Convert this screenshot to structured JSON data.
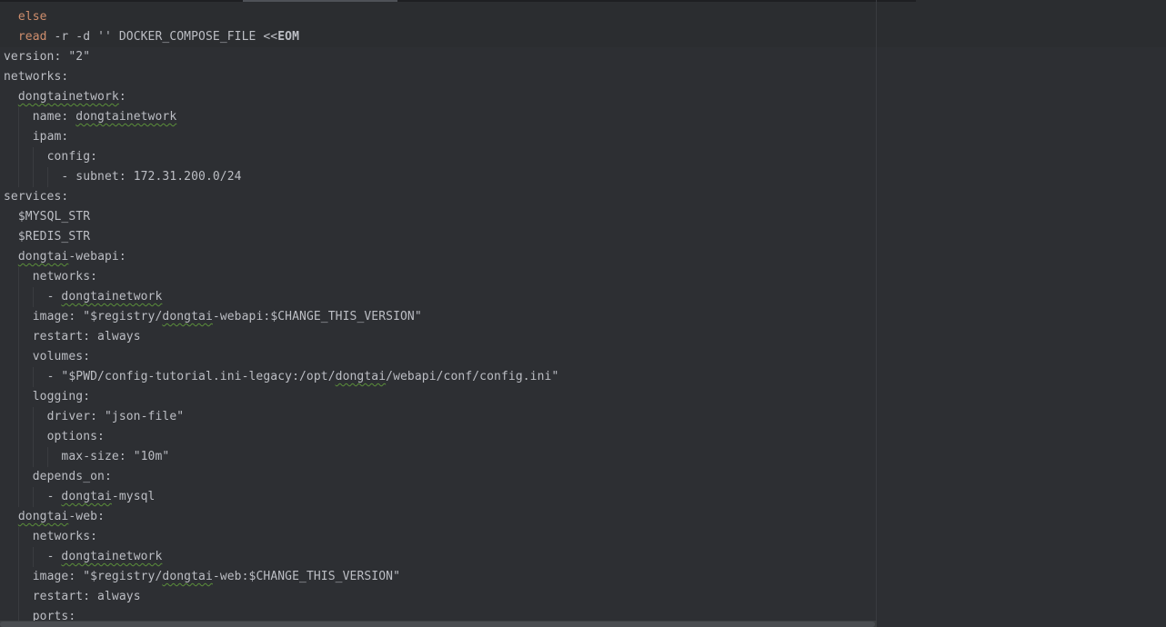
{
  "editor": {
    "lines": [
      {
        "indent": "  ",
        "segments": [
          {
            "text": "else",
            "style": "kw"
          }
        ]
      },
      {
        "indent": "  ",
        "segments": [
          {
            "text": "read",
            "style": "kw"
          },
          {
            "text": " -r -d '' DOCKER_COMPOSE_FILE <<",
            "style": ""
          },
          {
            "text": "EOM",
            "style": "bold"
          }
        ]
      },
      {
        "indent": "",
        "segments": [
          {
            "text": "version: \"2\"",
            "style": ""
          }
        ]
      },
      {
        "indent": "",
        "segments": [
          {
            "text": "networks:",
            "style": ""
          }
        ]
      },
      {
        "indent": "  ",
        "segments": [
          {
            "text": "dongtainetwork",
            "style": "squig"
          },
          {
            "text": ":",
            "style": ""
          }
        ]
      },
      {
        "indent": "    ",
        "segments": [
          {
            "text": "name: ",
            "style": ""
          },
          {
            "text": "dongtainetwork",
            "style": "squig"
          }
        ]
      },
      {
        "indent": "    ",
        "segments": [
          {
            "text": "ipam:",
            "style": ""
          }
        ]
      },
      {
        "indent": "      ",
        "segments": [
          {
            "text": "config:",
            "style": ""
          }
        ]
      },
      {
        "indent": "        ",
        "segments": [
          {
            "text": "- subnet: 172.31.200.0/24",
            "style": ""
          }
        ]
      },
      {
        "indent": "",
        "segments": [
          {
            "text": "services:",
            "style": ""
          }
        ]
      },
      {
        "indent": "  ",
        "segments": [
          {
            "text": "$MYSQL_STR",
            "style": ""
          }
        ]
      },
      {
        "indent": "  ",
        "segments": [
          {
            "text": "$REDIS_STR",
            "style": ""
          }
        ]
      },
      {
        "indent": "  ",
        "segments": [
          {
            "text": "dongtai",
            "style": "squig"
          },
          {
            "text": "-webapi:",
            "style": ""
          }
        ]
      },
      {
        "indent": "    ",
        "segments": [
          {
            "text": "networks:",
            "style": ""
          }
        ]
      },
      {
        "indent": "      ",
        "segments": [
          {
            "text": "- ",
            "style": ""
          },
          {
            "text": "dongtainetwork",
            "style": "squig"
          }
        ]
      },
      {
        "indent": "    ",
        "segments": [
          {
            "text": "image: \"$registry/",
            "style": ""
          },
          {
            "text": "dongtai",
            "style": "squig"
          },
          {
            "text": "-webapi:$CHANGE_THIS_VERSION\"",
            "style": ""
          }
        ]
      },
      {
        "indent": "    ",
        "segments": [
          {
            "text": "restart: always",
            "style": ""
          }
        ]
      },
      {
        "indent": "    ",
        "segments": [
          {
            "text": "volumes:",
            "style": ""
          }
        ]
      },
      {
        "indent": "      ",
        "segments": [
          {
            "text": "- \"$PWD/config-tutorial.ini-legacy:/opt/",
            "style": ""
          },
          {
            "text": "dongtai",
            "style": "squig"
          },
          {
            "text": "/webapi/conf/config.ini\"",
            "style": ""
          }
        ]
      },
      {
        "indent": "    ",
        "segments": [
          {
            "text": "logging:",
            "style": ""
          }
        ]
      },
      {
        "indent": "      ",
        "segments": [
          {
            "text": "driver: \"json-file\"",
            "style": ""
          }
        ]
      },
      {
        "indent": "      ",
        "segments": [
          {
            "text": "options:",
            "style": ""
          }
        ]
      },
      {
        "indent": "        ",
        "segments": [
          {
            "text": "max-size: \"10m\"",
            "style": ""
          }
        ]
      },
      {
        "indent": "    ",
        "segments": [
          {
            "text": "depends_on:",
            "style": ""
          }
        ]
      },
      {
        "indent": "      ",
        "segments": [
          {
            "text": "- ",
            "style": ""
          },
          {
            "text": "dongtai",
            "style": "squig"
          },
          {
            "text": "-mysql",
            "style": ""
          }
        ]
      },
      {
        "indent": "  ",
        "segments": [
          {
            "text": "dongtai",
            "style": "squig"
          },
          {
            "text": "-web:",
            "style": ""
          }
        ]
      },
      {
        "indent": "    ",
        "segments": [
          {
            "text": "networks:",
            "style": ""
          }
        ]
      },
      {
        "indent": "      ",
        "segments": [
          {
            "text": "- ",
            "style": ""
          },
          {
            "text": "dongtainetwork",
            "style": "squig"
          }
        ]
      },
      {
        "indent": "    ",
        "segments": [
          {
            "text": "image: \"$registry/",
            "style": ""
          },
          {
            "text": "dongtai",
            "style": "squig"
          },
          {
            "text": "-web:$CHANGE_THIS_VERSION\"",
            "style": ""
          }
        ]
      },
      {
        "indent": "    ",
        "segments": [
          {
            "text": "restart: always",
            "style": ""
          }
        ]
      },
      {
        "indent": "    ",
        "segments": [
          {
            "text": "ports:",
            "style": ""
          }
        ]
      }
    ]
  },
  "colors": {
    "background": "#2b2d30",
    "text": "#bcbec4",
    "keyword": "#cf8e6d",
    "typo_underline": "#5b8f3a"
  }
}
